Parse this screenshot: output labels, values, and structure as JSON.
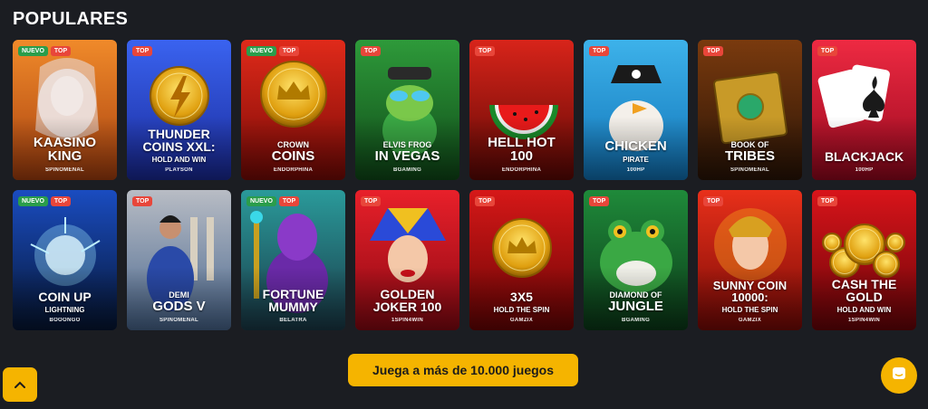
{
  "section": {
    "title": "POPULARES"
  },
  "games": [
    {
      "id": "kaasino-king",
      "badges": [
        "NUEVO",
        "TOP"
      ],
      "title": "KAASINO\nKING",
      "subtitle": "",
      "provider": "SPINOMENAL",
      "bg": [
        "#f08a2a",
        "#a8400f"
      ],
      "title_size": 15
    },
    {
      "id": "thunder-coins",
      "badges": [
        "TOP"
      ],
      "title": "THUNDER\nCOINS XXL:",
      "subtitle": "HOLD AND WIN",
      "provider": "PLAYSON",
      "bg": [
        "#3a63f0",
        "#1a2a9a"
      ],
      "title_size": 14
    },
    {
      "id": "crown-coins",
      "badges": [
        "NUEVO",
        "TOP"
      ],
      "title_small": "CROWN",
      "title": "COINS",
      "subtitle": "",
      "provider": "ENDORPHINA",
      "bg": [
        "#e02a1a",
        "#7a0a06"
      ],
      "title_size": 15
    },
    {
      "id": "elvis-frog",
      "badges": [
        "TOP"
      ],
      "title_small": "ELVIS FROG",
      "title": "IN VEGAS",
      "subtitle": "",
      "provider": "BGAMING",
      "bg": [
        "#2e9a3a",
        "#0f4a18"
      ],
      "title_size": 15
    },
    {
      "id": "hell-hot",
      "badges": [
        "TOP"
      ],
      "title": "HELL HOT\n100",
      "subtitle": "",
      "provider": "ENDORPHINA",
      "bg": [
        "#d8241a",
        "#5e0804"
      ],
      "title_size": 15
    },
    {
      "id": "chicken-pirate",
      "badges": [
        "TOP"
      ],
      "title": "CHICKEN",
      "subtitle": "PIRATE",
      "provider": "100HP",
      "bg": [
        "#3db2ea",
        "#1174b8"
      ],
      "title_size": 15
    },
    {
      "id": "book-of-tribes",
      "badges": [
        "TOP"
      ],
      "title_small": "BOOK OF",
      "title": "TRIBES",
      "subtitle": "",
      "provider": "SPINOMENAL",
      "bg": [
        "#7a3a0e",
        "#2a1406"
      ],
      "title_size": 15
    },
    {
      "id": "blackjack",
      "badges": [
        "TOP"
      ],
      "title": "BLACKJACK",
      "subtitle": "",
      "provider": "100HP",
      "bg": [
        "#ee2a42",
        "#98081e"
      ],
      "title_size": 14
    },
    {
      "id": "coin-up",
      "badges": [
        "NUEVO",
        "TOP"
      ],
      "title": "COIN UP",
      "subtitle": "LIGHTNING",
      "provider": "BOOONGO",
      "bg": [
        "#1a4cc0",
        "#061634"
      ],
      "title_size": 14
    },
    {
      "id": "demi-gods",
      "badges": [
        "TOP"
      ],
      "title_small": "DEMI",
      "title": "GODS V",
      "subtitle": "",
      "provider": "SPINOMENAL",
      "bg": [
        "#b8bcc4",
        "#4a6890"
      ],
      "title_size": 15
    },
    {
      "id": "fortune-mummy",
      "badges": [
        "NUEVO",
        "TOP"
      ],
      "title": "FORTUNE\nMUMMY",
      "subtitle": "",
      "provider": "BELATRA",
      "bg": [
        "#2a9a9a",
        "#1a3a48"
      ],
      "title_size": 14
    },
    {
      "id": "golden-joker",
      "badges": [
        "TOP"
      ],
      "title": "GOLDEN\nJOKER 100",
      "subtitle": "",
      "provider": "1SPIN4WIN",
      "bg": [
        "#e8202a",
        "#8a0812"
      ],
      "title_size": 14
    },
    {
      "id": "3x5",
      "badges": [
        "TOP"
      ],
      "title": "3X5",
      "subtitle": "HOLD THE SPIN",
      "provider": "GAMZIX",
      "bg": [
        "#d61818",
        "#6a0404"
      ],
      "title_size": 14
    },
    {
      "id": "diamond-jungle",
      "badges": [
        "TOP"
      ],
      "title_small": "DIAMOND OF",
      "title": "JUNGLE",
      "subtitle": "",
      "provider": "BGAMING",
      "bg": [
        "#1f8a3a",
        "#0b3a18"
      ],
      "title_size": 15
    },
    {
      "id": "sunny-coin",
      "badges": [
        "TOP"
      ],
      "title": "SUNNY COIN\n10000:",
      "subtitle": "HOLD THE SPIN",
      "provider": "GAMZIX",
      "bg": [
        "#e8301a",
        "#7a0a06"
      ],
      "title_size": 13
    },
    {
      "id": "cash-the-gold",
      "badges": [
        "TOP"
      ],
      "title": "CASH THE\nGOLD",
      "subtitle": "HOLD AND WIN",
      "provider": "1SPIN4WIN",
      "bg": [
        "#d8141a",
        "#6a0408"
      ],
      "title_size": 14
    }
  ],
  "cta": {
    "label": "Juega a más de 10.000 juegos"
  },
  "icons": {
    "scroll_top": "chevron-up-icon",
    "chat": "chat-icon"
  },
  "colors": {
    "accent": "#f5b400",
    "badge_new": "#2a9d4b",
    "badge_top": "#e8463a",
    "page_bg": "#1b1d22"
  }
}
